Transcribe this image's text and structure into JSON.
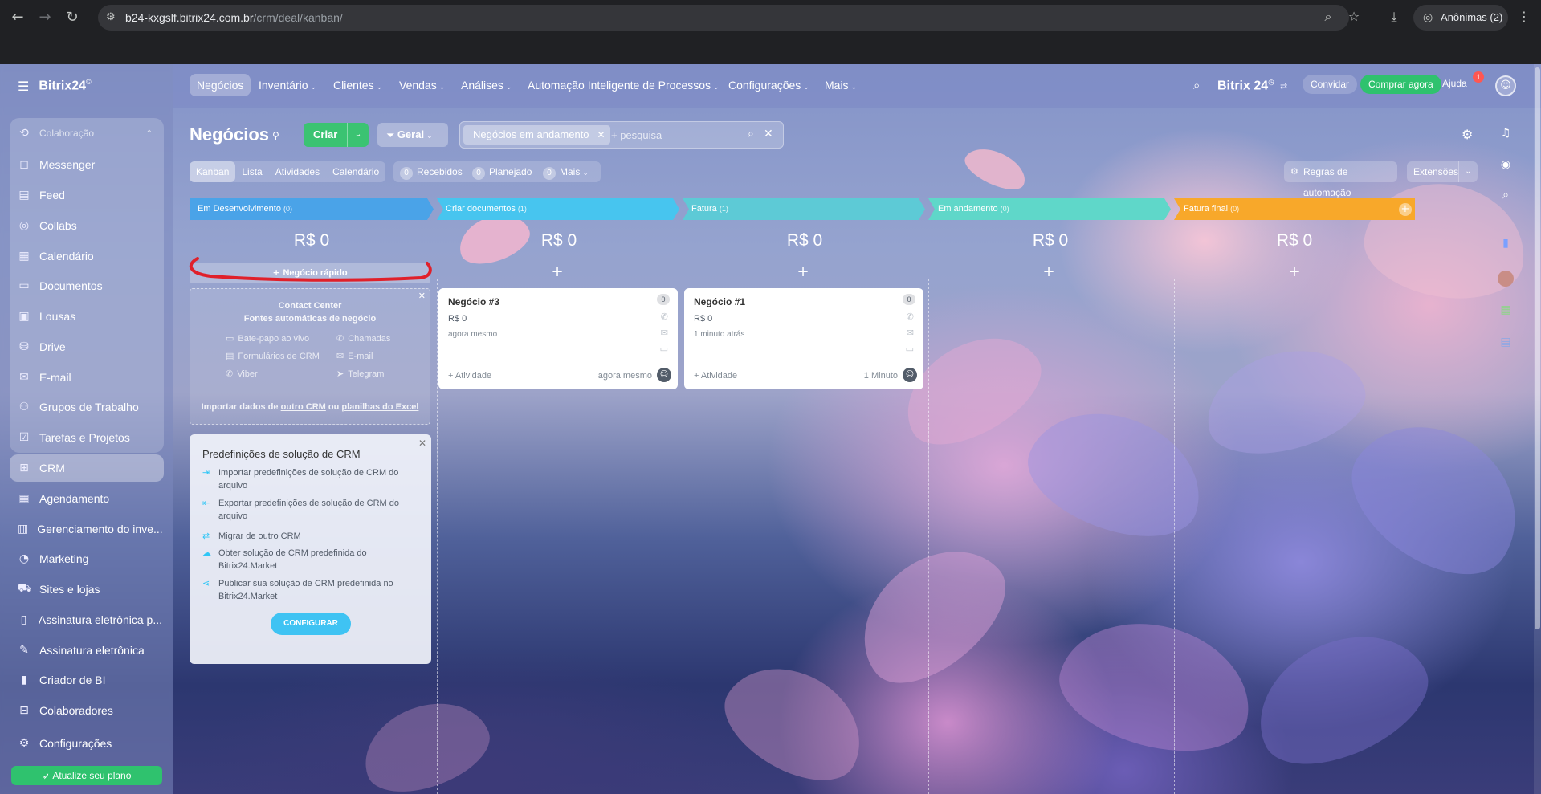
{
  "browser": {
    "url_host": "b24-kxgslf.bitrix24.com.br",
    "url_path": "/crm/deal/kanban/",
    "incognito_label": "Anônimas (2)"
  },
  "sidebar": {
    "brand": "Bitrix24",
    "brand_sup": "©",
    "group_label": "Colaboração",
    "items": [
      {
        "label": "Messenger",
        "icon": "chat-icon"
      },
      {
        "label": "Feed",
        "icon": "feed-icon"
      },
      {
        "label": "Collabs",
        "icon": "collabs-icon"
      },
      {
        "label": "Calendário",
        "icon": "calendar-icon"
      },
      {
        "label": "Documentos",
        "icon": "documents-icon"
      },
      {
        "label": "Lousas",
        "icon": "board-icon"
      },
      {
        "label": "Drive",
        "icon": "drive-icon"
      },
      {
        "label": "E-mail",
        "icon": "mail-icon"
      },
      {
        "label": "Grupos de Trabalho",
        "icon": "groups-icon"
      },
      {
        "label": "Tarefas e Projetos",
        "icon": "tasks-icon"
      },
      {
        "label": "CRM",
        "icon": "crm-icon"
      },
      {
        "label": "Agendamento",
        "icon": "booking-icon"
      },
      {
        "label": "Gerenciamento do inve...",
        "icon": "inventory-icon"
      },
      {
        "label": "Marketing",
        "icon": "marketing-icon"
      },
      {
        "label": "Sites e lojas",
        "icon": "store-icon"
      },
      {
        "label": "Assinatura eletrônica p...",
        "icon": "sign-icon"
      },
      {
        "label": "Assinatura eletrônica",
        "icon": "sign-pen-icon"
      },
      {
        "label": "Criador de BI",
        "icon": "bi-icon"
      },
      {
        "label": "Colaboradores",
        "icon": "employees-icon"
      },
      {
        "label": "Configurações",
        "icon": "settings-icon"
      }
    ],
    "upgrade_label": "Atualize seu plano"
  },
  "topnav": {
    "items": [
      "Negócios",
      "Inventário",
      "Clientes",
      "Vendas",
      "Análises",
      "Automação Inteligente de Processos",
      "Configurações",
      "Mais"
    ],
    "brand": "Bitrix 24",
    "invite": "Convidar",
    "buy": "Comprar agora",
    "help": "Ajuda",
    "help_badge": "1"
  },
  "page": {
    "title": "Negócios",
    "create": "Criar",
    "category": "Geral",
    "filter_tag": "Negócios em andamento",
    "search_placeholder": "+ pesquisa"
  },
  "views": [
    "Kanban",
    "Lista",
    "Atividades",
    "Calendário"
  ],
  "counters": [
    {
      "count": "0",
      "label": "Recebidos"
    },
    {
      "count": "0",
      "label": "Planejado"
    },
    {
      "count": "0",
      "label": "Mais"
    }
  ],
  "toolbar": {
    "automation": "Regras de automação",
    "extensions": "Extensões"
  },
  "columns": [
    {
      "title": "Em Desenvolvimento",
      "count": "(0)",
      "sum": "R$ 0",
      "color": "#4aa3e8"
    },
    {
      "title": "Criar documentos",
      "count": "(1)",
      "sum": "R$ 0",
      "color": "#47c5ef"
    },
    {
      "title": "Fatura",
      "count": "(1)",
      "sum": "R$ 0",
      "color": "#5dcad6"
    },
    {
      "title": "Em andamento",
      "count": "(0)",
      "sum": "R$ 0",
      "color": "#5fd7c9"
    },
    {
      "title": "Fatura final",
      "count": "(0)",
      "sum": "R$ 0",
      "color": "#f8a82a"
    }
  ],
  "quick_deal": "Negócio rápido",
  "contact_center": {
    "title": "Contact Center",
    "subtitle": "Fontes automáticas de negócio",
    "sources": [
      "Bate-papo ao vivo",
      "Chamadas",
      "Formulários de CRM",
      "E-mail",
      "Viber",
      "Telegram"
    ],
    "import_prefix": "Importar dados de",
    "import_link1": "outro CRM",
    "import_mid": "ou",
    "import_link2": "planilhas do Excel"
  },
  "presets": {
    "title": "Predefinições de solução de CRM",
    "items": [
      "Importar predefinições de solução de CRM do arquivo",
      "Exportar predefinições de solução de CRM do arquivo",
      "Migrar de outro CRM",
      "Obter solução de CRM predefinida do Bitrix24.Market",
      "Publicar sua solução de CRM predefinida no Bitrix24.Market"
    ],
    "button": "CONFIGURAR"
  },
  "cards": [
    {
      "name": "Negócio #3",
      "price": "R$ 0",
      "time": "agora mesmo",
      "activity": "+ Atividade",
      "when": "agora mesmo",
      "badge": "0"
    },
    {
      "name": "Negócio #1",
      "price": "R$ 0",
      "time": "1 minuto atrás",
      "activity": "+ Atividade",
      "when": "1 Minuto",
      "badge": "0"
    }
  ]
}
